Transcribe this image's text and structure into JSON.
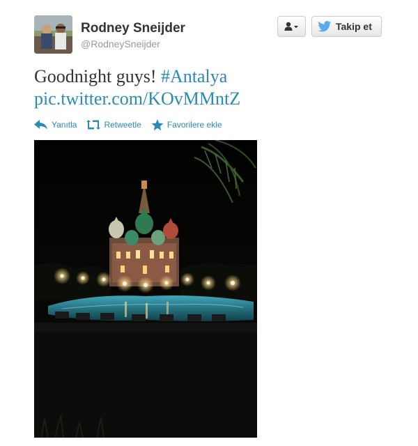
{
  "tweet": {
    "fullname": "Rodney Sneijder",
    "username": "@RodneySneijder",
    "text_plain": "Goodnight guys! ",
    "hashtag": "#Antalya",
    "pic_link": "pic.twitter.com/KOvMMntZ"
  },
  "buttons": {
    "user_dropdown_icon": "user-icon",
    "follow_label": "Takip et",
    "follow_icon": "twitter-bird-icon"
  },
  "actions": {
    "reply_label": "Yanıtla",
    "retweet_label": "Retweetle",
    "favorite_label": "Favorilere ekle"
  },
  "colors": {
    "link": "#2a8ab5",
    "text": "#333333",
    "muted": "#999999",
    "twitter_blue": "#55acee"
  }
}
